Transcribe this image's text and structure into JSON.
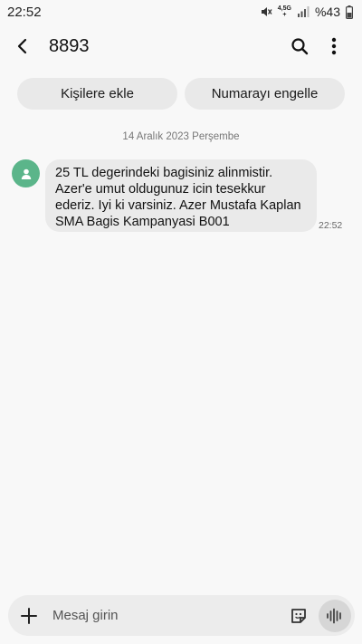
{
  "status_bar": {
    "time": "22:52",
    "network_top": "4,5G",
    "network_bottom": "+",
    "battery": "%43"
  },
  "app_bar": {
    "back_icon": "arrow-back-icon",
    "title": "8893",
    "search_icon": "search-icon",
    "more_icon": "more-vert-icon"
  },
  "actions": {
    "add_contact": "Kişilere ekle",
    "block_number": "Numarayı engelle"
  },
  "conversation": {
    "date": "14 Aralık 2023 Perşembe",
    "messages": [
      {
        "text": "25 TL degerindeki bagisiniz alinmistir. Azer'e umut oldugunuz icin tesekkur ederiz. Iyi ki varsiniz. Azer Mustafa Kaplan SMA Bagis Kampanyasi B001",
        "time": "22:52",
        "avatar_icon": "person-icon",
        "avatar_color": "#5bb58a"
      }
    ]
  },
  "composer": {
    "placeholder": "Mesaj girin",
    "add_icon": "plus-icon",
    "sticker_icon": "sticker-icon",
    "voice_icon": "voice-wave-icon"
  }
}
